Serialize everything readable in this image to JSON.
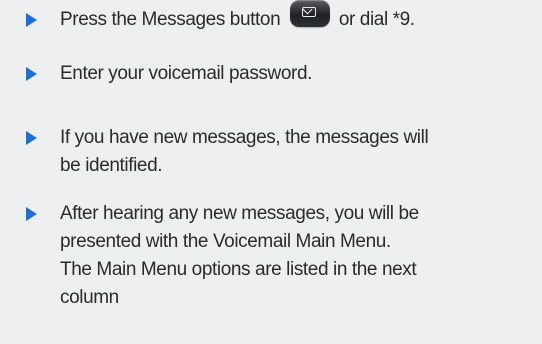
{
  "instructions": {
    "steps": [
      {
        "text_before": "Press the Messages button",
        "text_after": "or dial *9.",
        "icon": "envelope-icon"
      },
      {
        "lines": [
          "Enter your voicemail password."
        ]
      },
      {
        "lines": [
          "If you have new messages, the messages will",
          "be identified."
        ]
      },
      {
        "lines": [
          "After hearing any new messages, you will be",
          "presented with the Voicemail Main Menu.",
          "The Main Menu options are listed in the next",
          "column"
        ]
      }
    ]
  },
  "colors": {
    "bullet": "#1c6fd6",
    "text": "#2b2b2b",
    "background": "#eeeff0"
  }
}
